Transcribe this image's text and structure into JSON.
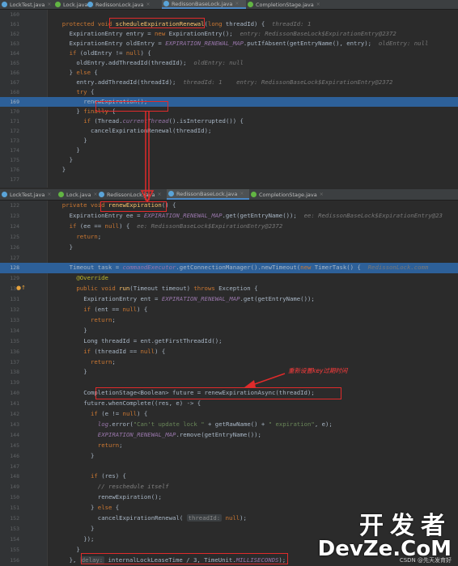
{
  "top_tabs": [
    {
      "label": "LockTest.java",
      "icon": "class-icon",
      "active": false
    },
    {
      "label": "Lock.java",
      "icon": "interface-icon",
      "active": false
    },
    {
      "label": "RedissonLock.java",
      "icon": "class-icon",
      "active": false
    },
    {
      "label": "RedissonBaseLock.java",
      "icon": "class-icon",
      "active": true
    },
    {
      "label": "CompletionStage.java",
      "icon": "interface-icon",
      "active": false
    }
  ],
  "bottom_tabs": [
    {
      "label": "LockTest.java",
      "icon": "class-icon",
      "active": false
    },
    {
      "label": "Lock.java",
      "icon": "interface-icon",
      "active": false
    },
    {
      "label": "RedissonLock.java",
      "icon": "class-icon",
      "active": false
    },
    {
      "label": "RedissonBaseLock.java",
      "icon": "class-icon",
      "active": true
    },
    {
      "label": "CompletionStage.java",
      "icon": "interface-icon",
      "active": false
    }
  ],
  "top_lines": [
    {
      "n": "160",
      "ind": 0,
      "hl": false,
      "parts": []
    },
    {
      "n": "161",
      "ind": 2,
      "hl": false,
      "parts": [
        [
          "kw",
          "protected void "
        ],
        [
          "fn",
          "scheduleExpirationRenewal"
        ],
        [
          "t",
          "("
        ],
        [
          "kw",
          "long "
        ],
        [
          "t",
          "threadId) {  "
        ],
        [
          "hint",
          "threadId: 1"
        ]
      ]
    },
    {
      "n": "162",
      "ind": 4,
      "hl": false,
      "parts": [
        [
          "t",
          "ExpirationEntry entry = "
        ],
        [
          "kw",
          "new "
        ],
        [
          "t",
          "ExpirationEntry();  "
        ],
        [
          "hint",
          "entry: RedissonBaseLock$ExpirationEntry@2372"
        ]
      ]
    },
    {
      "n": "163",
      "ind": 4,
      "hl": false,
      "parts": [
        [
          "t",
          "ExpirationEntry oldEntry = "
        ],
        [
          "cs",
          "EXPIRATION_RENEWAL_MAP"
        ],
        [
          "t",
          ".putIfAbsent(getEntryName(), entry);  "
        ],
        [
          "hint",
          "oldEntry: null"
        ]
      ]
    },
    {
      "n": "164",
      "ind": 4,
      "hl": false,
      "parts": [
        [
          "kw",
          "if "
        ],
        [
          "t",
          "(oldEntry != "
        ],
        [
          "kw",
          "null"
        ],
        [
          "t",
          ") {"
        ]
      ]
    },
    {
      "n": "165",
      "ind": 6,
      "hl": false,
      "parts": [
        [
          "t",
          "oldEntry.addThreadId(threadId);  "
        ],
        [
          "hint",
          "oldEntry: null"
        ]
      ]
    },
    {
      "n": "166",
      "ind": 4,
      "hl": false,
      "parts": [
        [
          "t",
          "} "
        ],
        [
          "kw",
          "else "
        ],
        [
          "t",
          "{"
        ]
      ]
    },
    {
      "n": "167",
      "ind": 6,
      "hl": false,
      "parts": [
        [
          "t",
          "entry.addThreadId(threadId);  "
        ],
        [
          "hint",
          "threadId: 1    entry: RedissonBaseLock$ExpirationEntry@2372"
        ]
      ]
    },
    {
      "n": "168",
      "ind": 6,
      "hl": false,
      "parts": [
        [
          "kw",
          "try "
        ],
        [
          "t",
          "{"
        ]
      ]
    },
    {
      "n": "169",
      "ind": 8,
      "hl": true,
      "parts": [
        [
          "t",
          "renewExpiration();"
        ]
      ]
    },
    {
      "n": "170",
      "ind": 6,
      "hl": false,
      "parts": [
        [
          "t",
          "} "
        ],
        [
          "kw",
          "finally "
        ],
        [
          "t",
          "{"
        ]
      ]
    },
    {
      "n": "171",
      "ind": 8,
      "hl": false,
      "parts": [
        [
          "kw",
          "if "
        ],
        [
          "t",
          "(Thread."
        ],
        [
          "cs",
          "currentThread"
        ],
        [
          "t",
          "().isInterrupted()) {"
        ]
      ]
    },
    {
      "n": "172",
      "ind": 10,
      "hl": false,
      "parts": [
        [
          "t",
          "cancelExpirationRenewal(threadId);"
        ]
      ]
    },
    {
      "n": "173",
      "ind": 8,
      "hl": false,
      "parts": [
        [
          "t",
          "}"
        ]
      ]
    },
    {
      "n": "174",
      "ind": 6,
      "hl": false,
      "parts": [
        [
          "t",
          "}"
        ]
      ]
    },
    {
      "n": "175",
      "ind": 4,
      "hl": false,
      "parts": [
        [
          "t",
          "}"
        ]
      ]
    },
    {
      "n": "176",
      "ind": 2,
      "hl": false,
      "parts": [
        [
          "t",
          "}"
        ]
      ]
    },
    {
      "n": "177",
      "ind": 0,
      "hl": false,
      "parts": []
    }
  ],
  "bottom_lines": [
    {
      "n": "122",
      "ind": 2,
      "hl": false,
      "parts": [
        [
          "kw",
          "private void "
        ],
        [
          "fn",
          "renewExpiration"
        ],
        [
          "t",
          "() {"
        ]
      ]
    },
    {
      "n": "123",
      "ind": 4,
      "hl": false,
      "parts": [
        [
          "t",
          "ExpirationEntry ee = "
        ],
        [
          "cs",
          "EXPIRATION_RENEWAL_MAP"
        ],
        [
          "t",
          ".get(getEntryName());  "
        ],
        [
          "hint",
          "ee: RedissonBaseLock$ExpirationEntry@23"
        ]
      ]
    },
    {
      "n": "124",
      "ind": 4,
      "hl": false,
      "parts": [
        [
          "kw",
          "if "
        ],
        [
          "t",
          "(ee == "
        ],
        [
          "kw",
          "null"
        ],
        [
          "t",
          ") {  "
        ],
        [
          "hint",
          "ee: RedissonBaseLock$ExpirationEntry@2372"
        ]
      ]
    },
    {
      "n": "125",
      "ind": 6,
      "hl": false,
      "parts": [
        [
          "kw",
          "return"
        ],
        [
          "t",
          ";"
        ]
      ]
    },
    {
      "n": "126",
      "ind": 4,
      "hl": false,
      "parts": [
        [
          "t",
          "}"
        ]
      ]
    },
    {
      "n": "127",
      "ind": 0,
      "hl": false,
      "parts": []
    },
    {
      "n": "128",
      "ind": 4,
      "hl": true,
      "parts": [
        [
          "t",
          "Timeout task = "
        ],
        [
          "cs",
          "commandExecutor"
        ],
        [
          "t",
          ".getConnectionManager().newTimeout("
        ],
        [
          "kw",
          "new "
        ],
        [
          "t",
          "TimerTask() {  "
        ],
        [
          "hint",
          "RedissonLock.comm"
        ]
      ]
    },
    {
      "n": "129",
      "ind": 6,
      "hl": false,
      "parts": [
        [
          "anno",
          "@Override"
        ]
      ]
    },
    {
      "n": "130",
      "ind": 6,
      "hl": false,
      "parts": [
        [
          "kw",
          "public void "
        ],
        [
          "fn",
          "run"
        ],
        [
          "t",
          "(Timeout timeout) "
        ],
        [
          "kw",
          "throws "
        ],
        [
          "t",
          "Exception {"
        ]
      ]
    },
    {
      "n": "131",
      "ind": 8,
      "hl": false,
      "parts": [
        [
          "t",
          "ExpirationEntry ent = "
        ],
        [
          "cs",
          "EXPIRATION_RENEWAL_MAP"
        ],
        [
          "t",
          ".get(getEntryName());"
        ]
      ]
    },
    {
      "n": "132",
      "ind": 8,
      "hl": false,
      "parts": [
        [
          "kw",
          "if "
        ],
        [
          "t",
          "(ent == "
        ],
        [
          "kw",
          "null"
        ],
        [
          "t",
          ") {"
        ]
      ]
    },
    {
      "n": "133",
      "ind": 10,
      "hl": false,
      "parts": [
        [
          "kw",
          "return"
        ],
        [
          "t",
          ";"
        ]
      ]
    },
    {
      "n": "134",
      "ind": 8,
      "hl": false,
      "parts": [
        [
          "t",
          "}"
        ]
      ]
    },
    {
      "n": "135",
      "ind": 8,
      "hl": false,
      "parts": [
        [
          "t",
          "Long threadId = ent.getFirstThreadId();"
        ]
      ]
    },
    {
      "n": "136",
      "ind": 8,
      "hl": false,
      "parts": [
        [
          "kw",
          "if "
        ],
        [
          "t",
          "(threadId == "
        ],
        [
          "kw",
          "null"
        ],
        [
          "t",
          ") {"
        ]
      ]
    },
    {
      "n": "137",
      "ind": 10,
      "hl": false,
      "parts": [
        [
          "kw",
          "return"
        ],
        [
          "t",
          ";"
        ]
      ]
    },
    {
      "n": "138",
      "ind": 8,
      "hl": false,
      "parts": [
        [
          "t",
          "}"
        ]
      ]
    },
    {
      "n": "139",
      "ind": 0,
      "hl": false,
      "parts": []
    },
    {
      "n": "140",
      "ind": 8,
      "hl": false,
      "parts": [
        [
          "t",
          "CompletionStage<Boolean> future = renewExpirationAsync(threadId);"
        ]
      ]
    },
    {
      "n": "141",
      "ind": 8,
      "hl": false,
      "parts": [
        [
          "t",
          "future.whenComplete((res, e) -> {"
        ]
      ]
    },
    {
      "n": "142",
      "ind": 10,
      "hl": false,
      "parts": [
        [
          "kw",
          "if "
        ],
        [
          "t",
          "(e != "
        ],
        [
          "kw",
          "null"
        ],
        [
          "t",
          ") {"
        ]
      ]
    },
    {
      "n": "143",
      "ind": 12,
      "hl": false,
      "parts": [
        [
          "cs",
          "log"
        ],
        [
          "t",
          ".error("
        ],
        [
          "st",
          "\"Can't update lock \""
        ],
        [
          "t",
          " + getRawName() + "
        ],
        [
          "st",
          "\" expiration\""
        ],
        [
          "t",
          ", e);"
        ]
      ]
    },
    {
      "n": "144",
      "ind": 12,
      "hl": false,
      "parts": [
        [
          "cs",
          "EXPIRATION_RENEWAL_MAP"
        ],
        [
          "t",
          ".remove(getEntryName());"
        ]
      ]
    },
    {
      "n": "145",
      "ind": 12,
      "hl": false,
      "parts": [
        [
          "kw",
          "return"
        ],
        [
          "t",
          ";"
        ]
      ]
    },
    {
      "n": "146",
      "ind": 10,
      "hl": false,
      "parts": [
        [
          "t",
          "}"
        ]
      ]
    },
    {
      "n": "147",
      "ind": 0,
      "hl": false,
      "parts": []
    },
    {
      "n": "148",
      "ind": 10,
      "hl": false,
      "parts": [
        [
          "kw",
          "if "
        ],
        [
          "t",
          "(res) {"
        ]
      ]
    },
    {
      "n": "149",
      "ind": 12,
      "hl": false,
      "parts": [
        [
          "cmt",
          "// reschedule itself"
        ]
      ]
    },
    {
      "n": "150",
      "ind": 12,
      "hl": false,
      "parts": [
        [
          "t",
          "renewExpiration();"
        ]
      ]
    },
    {
      "n": "151",
      "ind": 10,
      "hl": false,
      "parts": [
        [
          "t",
          "} "
        ],
        [
          "kw",
          "else "
        ],
        [
          "t",
          "{"
        ]
      ]
    },
    {
      "n": "152",
      "ind": 12,
      "hl": false,
      "parts": [
        [
          "t",
          "cancelExpirationRenewal( "
        ],
        [
          "inl",
          "threadId:"
        ],
        [
          "t",
          " "
        ],
        [
          "kw",
          "null"
        ],
        [
          "t",
          ");"
        ]
      ]
    },
    {
      "n": "153",
      "ind": 10,
      "hl": false,
      "parts": [
        [
          "t",
          "}"
        ]
      ]
    },
    {
      "n": "154",
      "ind": 8,
      "hl": false,
      "parts": [
        [
          "t",
          "});"
        ]
      ]
    },
    {
      "n": "155",
      "ind": 6,
      "hl": false,
      "parts": [
        [
          "t",
          "}"
        ]
      ]
    },
    {
      "n": "156",
      "ind": 4,
      "hl": false,
      "parts": [
        [
          "t",
          "}, "
        ],
        [
          "inl",
          "delay:"
        ],
        [
          "t",
          " internalLockLeaseTime / 3, TimeUnit."
        ],
        [
          "cs",
          "MILLISECONDS"
        ],
        [
          "t",
          ");"
        ]
      ]
    }
  ],
  "note": "重新设置key过期时间",
  "watermark": {
    "cn": "开发者",
    "en": "DevZe.CoM",
    "sub": "CSDN @先天发育好"
  },
  "colors": {
    "highlight": "#2d6099",
    "annotation": "#e02b2b",
    "background": "#2b2b2b"
  }
}
